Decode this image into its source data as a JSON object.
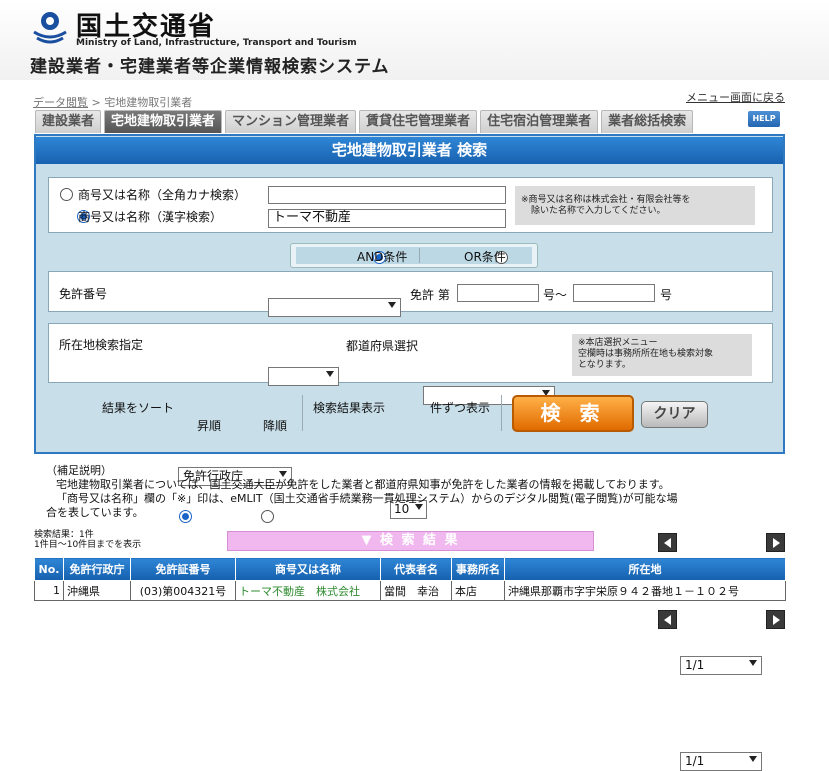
{
  "header": {
    "ministry_jp": "国土交通省",
    "ministry_en": "Ministry of Land, Infrastructure, Transport and Tourism",
    "system_title": "建設業者・宅建業者等企業情報検索システム"
  },
  "breadcrumb": {
    "parent": "データ閲覧",
    "separator": ">",
    "current": "宅地建物取引業者"
  },
  "menu_link": "メニュー画面に戻る",
  "tabs": [
    {
      "label": "建設業者",
      "active": false
    },
    {
      "label": "宅地建物取引業者",
      "active": true
    },
    {
      "label": "マンション管理業者",
      "active": false
    },
    {
      "label": "賃貸住宅管理業者",
      "active": false
    },
    {
      "label": "住宅宿泊管理業者",
      "active": false
    },
    {
      "label": "業者総括検索",
      "active": false
    }
  ],
  "help_label": "HELP",
  "panel_title": "宅地建物取引業者 検索",
  "name_search": {
    "kana_label": "商号又は名称（全角カナ検索）",
    "kanji_label": "商号又は名称（漢字検索）",
    "kana_value": "",
    "kanji_value": "トーマ不動産",
    "selected": "kanji",
    "note_line1": "※商号又は名称は株式会社・有限会社等を",
    "note_line2": "除いた名称で入力してください。"
  },
  "condition": {
    "and_label": "AND条件",
    "or_label": "OR条件",
    "selected": "and"
  },
  "license": {
    "label": "免許番号",
    "select_value": "",
    "mid_label": "免許 第",
    "from_value": "",
    "from_suffix": "号～",
    "to_value": "",
    "to_suffix": "号"
  },
  "location": {
    "label": "所在地検索指定",
    "select_value": "",
    "pref_label": "都道府県選択",
    "pref_value": "",
    "note_line1": "※本店選択メニュー",
    "note_line2": "空欄時は事務所所在地も検索対象",
    "note_line3": "となります。"
  },
  "sort": {
    "label": "結果をソート",
    "value": "免許行政庁",
    "asc_label": "昇順",
    "desc_label": "降順",
    "selected": "asc"
  },
  "page_size": {
    "label": "検索結果表示",
    "value": "10",
    "suffix": "件ずつ表示"
  },
  "buttons": {
    "search": "検 索",
    "clear": "クリア"
  },
  "supplement": {
    "line1": "（補足説明）",
    "line2": "宅地建物取引業者については、国土交通大臣が免許をした業者と都道府県知事が免許をした業者の情報を掲載しております。",
    "line3": "「商号又は名称」欄の「※」印は、eMLIT（国土交通省手続業務一貫処理システム）からのデジタル閲覧(電子閲覧)が可能な場",
    "line4": "合を表しています。"
  },
  "results": {
    "count_text": "検索結果：1件",
    "range_text": "1件目～10件目までを表示",
    "bar_label": "▼ 検 索 結 果",
    "page_value": "1/1",
    "columns": [
      "No.",
      "免許行政庁",
      "免許証番号",
      "商号又は名称",
      "代表者名",
      "事務所名",
      "所在地"
    ],
    "rows": [
      [
        "1",
        "沖縄県",
        "(03)第004321号",
        "トーマ不動産　株式会社",
        "當間　幸治",
        "本店",
        "沖縄県那覇市字宇栄原９４２番地１－１０２号"
      ]
    ]
  },
  "colors": {
    "accent_blue": "#2f78c2",
    "search_orange": "#e06b00",
    "result_bar": "#f0b8ee",
    "link_green": "#2e8b2e"
  }
}
